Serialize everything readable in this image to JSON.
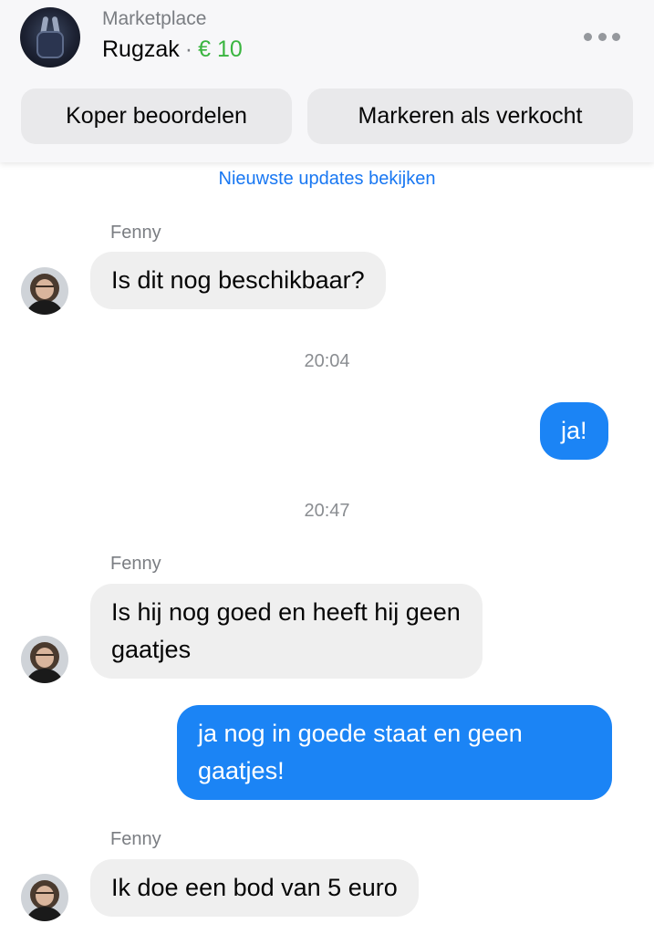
{
  "header": {
    "source": "Marketplace",
    "item": "Rugzak",
    "separator": "·",
    "price": "€ 10",
    "buttons": {
      "rate_buyer": "Koper beoordelen",
      "mark_sold": "Markeren als verkocht"
    }
  },
  "chat": {
    "updates_link": "Nieuwste updates bekijken",
    "contact_name": "Fenny",
    "messages": [
      {
        "from": "Fenny",
        "text": "Is dit nog beschikbaar?"
      },
      {
        "time": "20:04"
      },
      {
        "from": "me",
        "text": "ja!"
      },
      {
        "time": "20:47"
      },
      {
        "from": "Fenny",
        "text": "Is hij nog goed en heeft hij geen gaatjes"
      },
      {
        "from": "me",
        "text": "ja nog in goede staat en geen gaatjes!"
      },
      {
        "from": "Fenny",
        "text": "Ik doe een bod van 5 euro"
      }
    ]
  },
  "icons": {
    "more": "more-horizontal-icon",
    "listing": "backpack-photo",
    "contact_avatar": "avatar-photo"
  },
  "colors": {
    "price": "#3ab540",
    "link": "#1877f2",
    "outgoing_bubble": "#1b84f5",
    "incoming_bubble": "#efefef"
  }
}
